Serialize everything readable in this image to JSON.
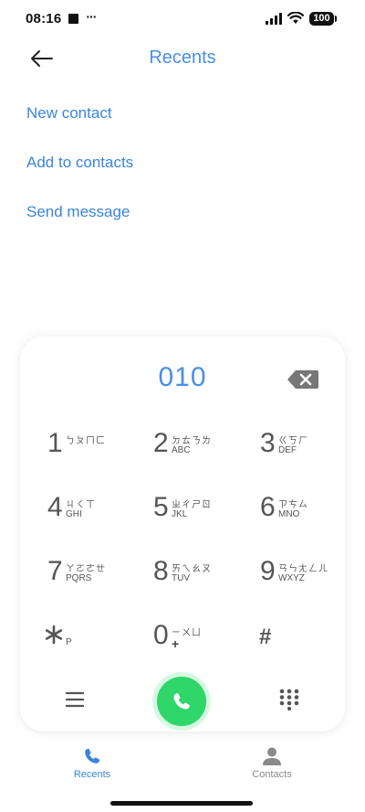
{
  "status_bar": {
    "time": "08:16",
    "dots": "···",
    "battery": "100"
  },
  "header": {
    "title": "Recents",
    "back_icon": "arrow-left-icon"
  },
  "actions": [
    {
      "label": "New contact"
    },
    {
      "label": "Add to contacts"
    },
    {
      "label": "Send message"
    }
  ],
  "dialpad": {
    "number": "010",
    "keys": [
      {
        "digit": "1",
        "sub1": "ㄅㄆㄇㄈ",
        "sub2": ""
      },
      {
        "digit": "2",
        "sub1": "ㄉㄊㄋㄌ",
        "sub2": "ABC"
      },
      {
        "digit": "3",
        "sub1": "ㄍㄎㄏ",
        "sub2": "DEF"
      },
      {
        "digit": "4",
        "sub1": "ㄐㄑㄒ",
        "sub2": "GHI"
      },
      {
        "digit": "5",
        "sub1": "ㄓㄔㄕㄖ",
        "sub2": "JKL"
      },
      {
        "digit": "6",
        "sub1": "ㄗㄘㄙ",
        "sub2": "MNO"
      },
      {
        "digit": "7",
        "sub1": "ㄚㄛㄜㄝ",
        "sub2": "PQRS"
      },
      {
        "digit": "8",
        "sub1": "ㄞㄟㄠㄡ",
        "sub2": "TUV"
      },
      {
        "digit": "9",
        "sub1": "ㄢㄣㄤㄥㄦ",
        "sub2": "WXYZ"
      },
      {
        "digit": "*",
        "sub1": "",
        "sub2": "P"
      },
      {
        "digit": "0",
        "sub1": "ㄧㄨㄩ",
        "sub2": "+"
      },
      {
        "digit": "#",
        "sub1": "",
        "sub2": ""
      }
    ]
  },
  "bottom_nav": {
    "items": [
      {
        "label": "Recents",
        "active": true
      },
      {
        "label": "Contacts",
        "active": false
      }
    ]
  },
  "colors": {
    "accent": "#4a8ee6",
    "link": "#3a84de",
    "call": "#2fd66a",
    "inactive": "#8a8a8a"
  }
}
